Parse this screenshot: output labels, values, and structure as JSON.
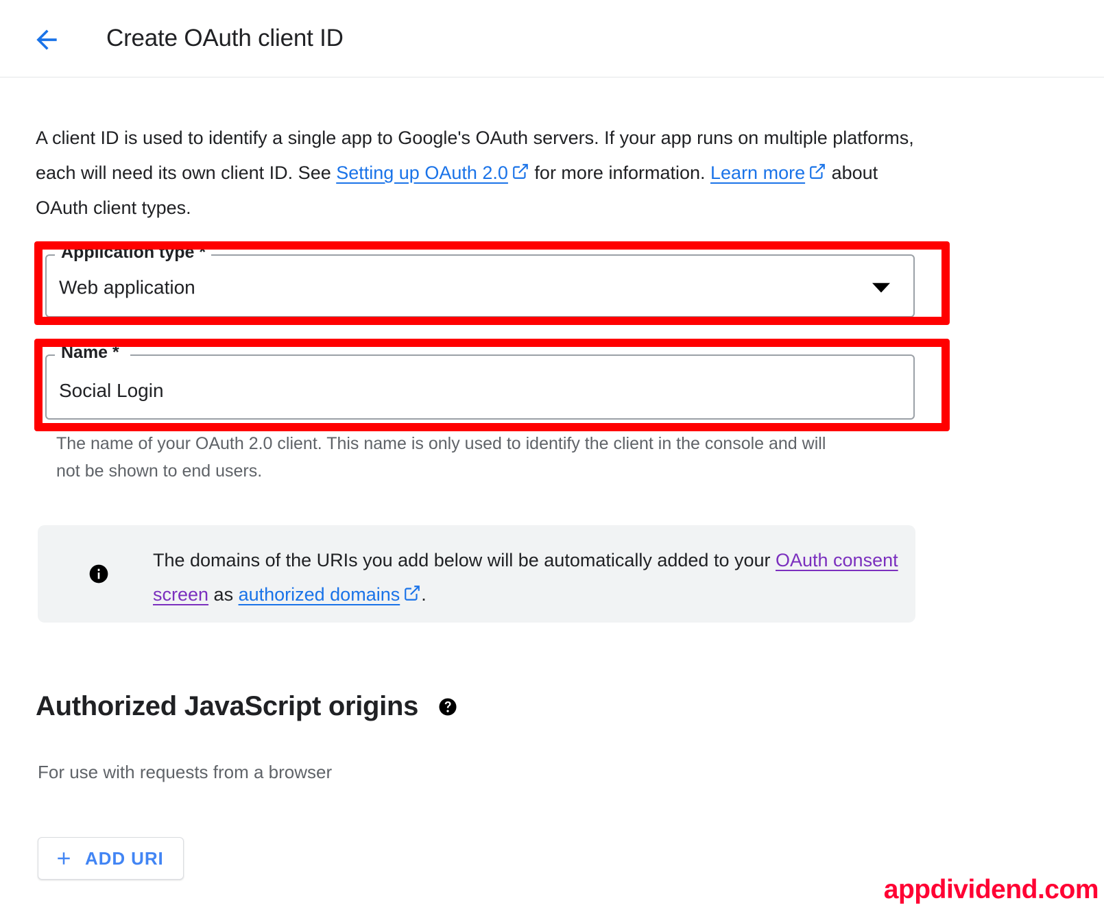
{
  "header": {
    "back_icon": "arrow-back-icon",
    "title": "Create OAuth client ID"
  },
  "intro": {
    "part1": "A client ID is used to identify a single app to Google's OAuth servers. If your app runs on multiple platforms, each will need its own client ID. See ",
    "link_oauth2": "Setting up OAuth 2.0",
    "part2": " for more information. ",
    "link_learn_more": "Learn more",
    "part3": " about OAuth client types."
  },
  "fields": {
    "application_type": {
      "label": "Application type *",
      "value": "Web application",
      "arrow_icon": "chevron-down-icon",
      "highlighted": true
    },
    "name": {
      "label": "Name *",
      "value": "Social Login",
      "placeholder": "Name",
      "highlighted": true,
      "helper": "The name of your OAuth 2.0 client. This name is only used to identify the client in the console and will not be shown to end users."
    }
  },
  "banner": {
    "icon": "info-icon",
    "part1": "The domains of the URIs you add below will be automatically added to your ",
    "link_consent": "OAuth consent screen",
    "part2": " as ",
    "link_domains": "authorized domains",
    "part3": "."
  },
  "section": {
    "title": "Authorized JavaScript origins",
    "help_icon": "help-circle-icon",
    "subtitle": "For use with requests from a browser",
    "add_uri_label": "ADD URI",
    "add_uri_icon": "plus-icon"
  },
  "watermark": "appdividend.com",
  "colors": {
    "link_blue": "#1a73e8",
    "visited_purple": "#7b2fbe",
    "button_blue": "#4285f4",
    "highlight_red": "#ff0000",
    "watermark_red": "#ff0033",
    "banner_bg": "#f1f3f4",
    "text_primary": "#202124",
    "text_secondary": "#5f6368"
  }
}
